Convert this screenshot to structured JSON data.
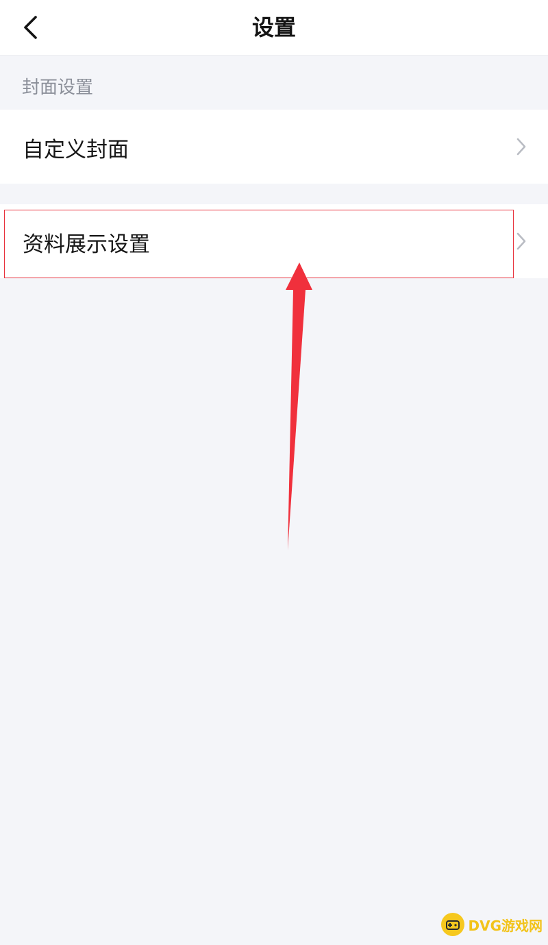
{
  "header": {
    "title": "设置",
    "back_icon": "chevron-left-icon"
  },
  "sections": {
    "cover_settings_label": "封面设置"
  },
  "items": [
    {
      "label": "自定义封面",
      "icon": "chevron-right-icon"
    },
    {
      "label": "资料展示设置",
      "icon": "chevron-right-icon"
    }
  ],
  "annotation": {
    "highlight_color": "#e8313c",
    "arrow_color": "#f0303c"
  },
  "watermark": {
    "text": "DVG游戏网",
    "accent_color": "#f6c81e"
  },
  "colors": {
    "background": "#f4f5f9",
    "surface": "#ffffff",
    "secondary_text": "#8b8f99"
  }
}
